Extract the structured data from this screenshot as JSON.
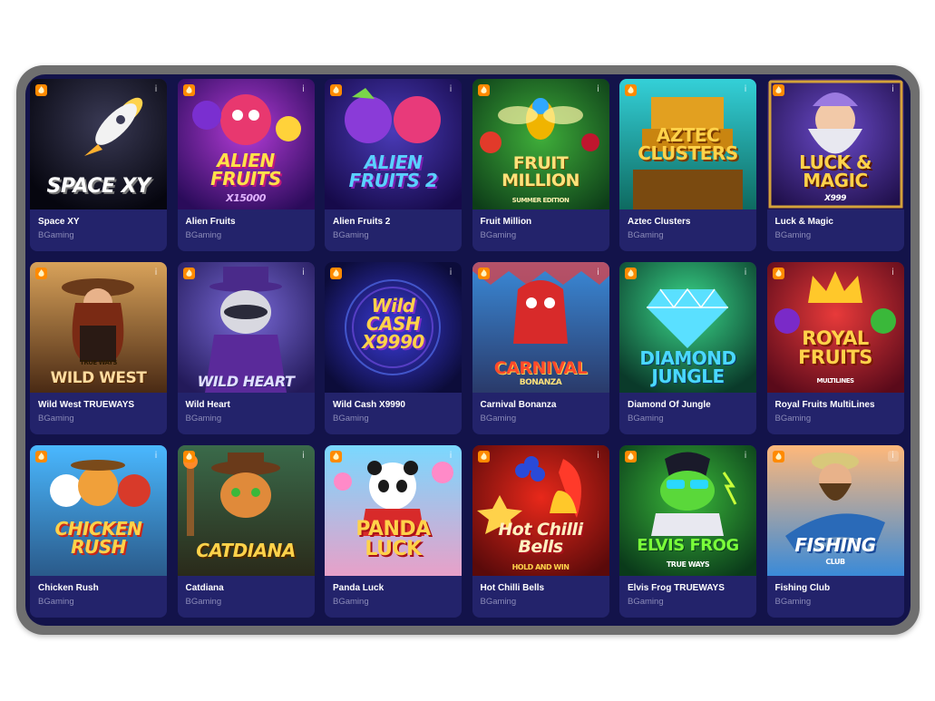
{
  "games": [
    {
      "name": "Space XY",
      "provider": "BGaming",
      "art": "SPACE XY",
      "icon": "fire-icon"
    },
    {
      "name": "Alien Fruits",
      "provider": "BGaming",
      "art": "ALIEN FRUITS",
      "art_sub": "X15000",
      "icon": "fire-icon"
    },
    {
      "name": "Alien Fruits 2",
      "provider": "BGaming",
      "art": "ALIEN FRUITS 2",
      "icon": "fire-icon"
    },
    {
      "name": "Fruit Million",
      "provider": "BGaming",
      "art": "FRUIT MILLION",
      "art_sub": "SUMMER EDITION",
      "icon": "fire-icon"
    },
    {
      "name": "Aztec Clusters",
      "provider": "BGaming",
      "art": "AZTEC CLUSTERS",
      "icon": "fire-icon"
    },
    {
      "name": "Luck & Magic",
      "provider": "BGaming",
      "art": "LUCK & MAGIC",
      "art_sub": "X999",
      "icon": "fire-icon"
    },
    {
      "name": "Wild West TRUEWAYS",
      "provider": "BGaming",
      "art": "WILD WEST",
      "art_sub": "TRUE WAYS",
      "icon": "fire-icon"
    },
    {
      "name": "Wild Heart",
      "provider": "BGaming",
      "art": "WILD HEART",
      "icon": "fire-icon"
    },
    {
      "name": "Wild Cash X9990",
      "provider": "BGaming",
      "art": "Wild CASH X9990",
      "icon": "fire-icon"
    },
    {
      "name": "Carnival Bonanza",
      "provider": "BGaming",
      "art": "CARNIVAL",
      "art_sub": "BONANZA",
      "icon": "fire-icon"
    },
    {
      "name": "Diamond Of Jungle",
      "provider": "BGaming",
      "art": "DIAMOND JUNGLE",
      "icon": "fire-icon"
    },
    {
      "name": "Royal Fruits MultiLines",
      "provider": "BGaming",
      "art": "ROYAL FRUITS",
      "art_sub": "MULTILINES",
      "icon": "fire-icon"
    },
    {
      "name": "Chicken Rush",
      "provider": "BGaming",
      "art": "CHICKEN RUSH",
      "icon": "fire-icon"
    },
    {
      "name": "Catdiana",
      "provider": "BGaming",
      "art": "CATDIANA",
      "icon": "fire-icon"
    },
    {
      "name": "Panda Luck",
      "provider": "BGaming",
      "art": "PANDA LUCK",
      "icon": "fire-icon"
    },
    {
      "name": "Hot Chilli Bells",
      "provider": "BGaming",
      "art": "Hot Chilli Bells",
      "art_sub": "HOLD AND WIN",
      "icon": "fire-icon"
    },
    {
      "name": "Elvis Frog TRUEWAYS",
      "provider": "BGaming",
      "art": "ELVIS FROG",
      "art_sub": "TRUE WAYS",
      "icon": "fire-icon"
    },
    {
      "name": "Fishing Club",
      "provider": "BGaming",
      "art": "FISHING",
      "art_sub": "CLUB",
      "icon": "fire-icon"
    }
  ],
  "info_glyph": "i",
  "colors": {
    "background": "#13134a",
    "card": "#23236b",
    "badge": "#ff8a00",
    "provider_text": "#8b8bb8"
  }
}
